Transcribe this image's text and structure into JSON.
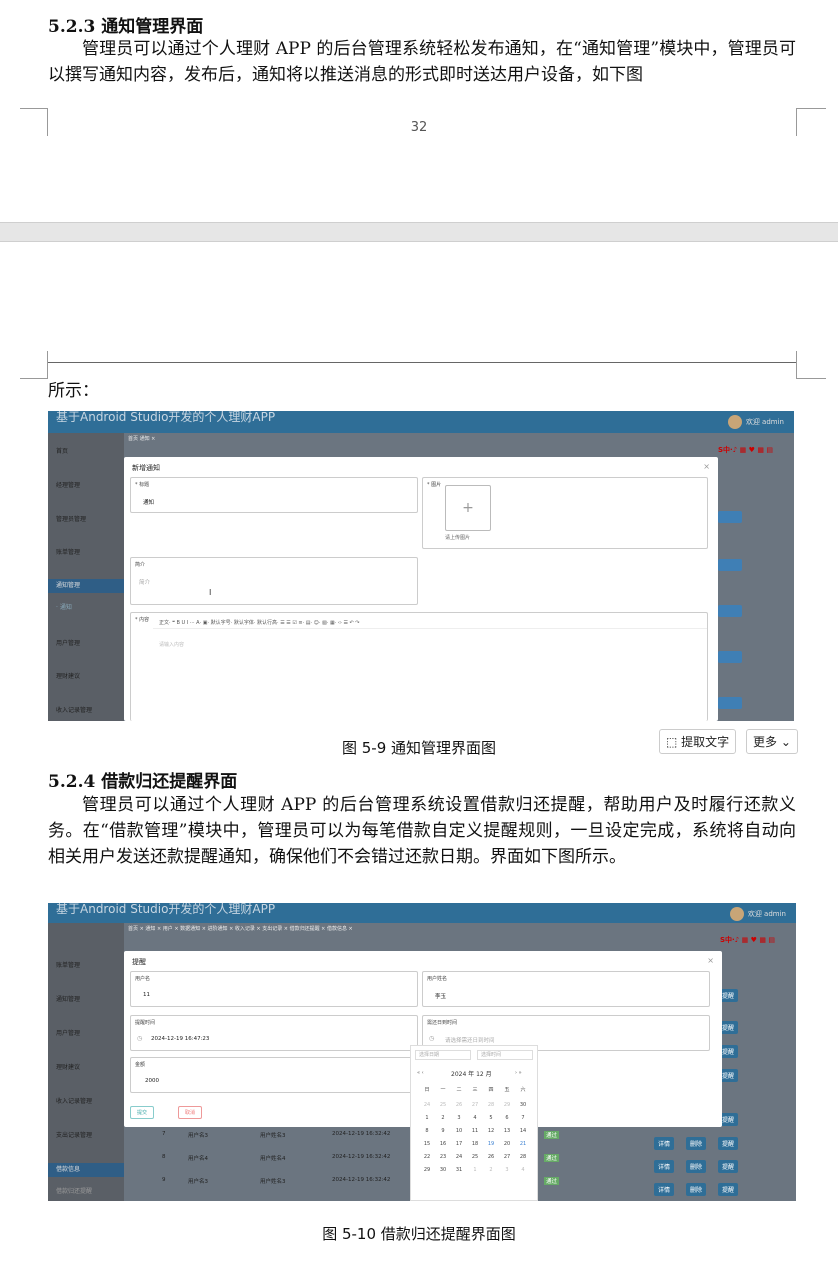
{
  "page1": {
    "heading": "5.2.3 通知管理界面",
    "paragraph": "管理员可以通过个人理财 APP 的后台管理系统轻松发布通知，在“通知管理”模块中，管理员可以撰写通知内容，发布后，通知将以推送消息的形式即时送达用户设备，如下图",
    "page_number": "32"
  },
  "page2": {
    "continuation": "所示：",
    "figure1": {
      "caption": "图 5-9 通知管理界面图",
      "app_title": "基于Android Studio开发的个人理财APP",
      "admin": "欢迎 admin",
      "tabs": "首页  通知 ×",
      "sidebar": [
        "首页",
        "经理管理",
        "管理员管理",
        "账单管理",
        "通知管理",
        "· 通知",
        "用户管理",
        "理财建议",
        "收入记录管理"
      ],
      "modal": {
        "title": "新增通知",
        "close": "×",
        "title_label": "* 标题",
        "title_value": "通知",
        "image_label": "* 图片",
        "image_hint": "请上传图片",
        "intro_label": "简介",
        "intro_placeholder": "简介",
        "content_label": "* 内容",
        "toolbar": "正文·   ❝   B  U  I  ···  A·  ▣·     默认字号·   默认字体·   默认行高·     ☰  ☰  ☑  ≡·  ▤·     ☺·  ▧·  ▦·  ‹›  ☰     ↶  ↷",
        "content_placeholder": "请输入内容"
      },
      "row_button": "通知",
      "ime": "S中·♪ ▦ ♥ ▦ ▤"
    },
    "tool_buttons": {
      "extract": "提取文字",
      "more": "更多"
    },
    "heading2": "5.2.4 借款归还提醒界面",
    "paragraph2": "管理员可以通过个人理财 APP 的后台管理系统设置借款归还提醒，帮助用户及时履行还款义务。在“借款管理”模块中，管理员可以为每笔借款自定义提醒规则，一旦设定完成，系统将自动向相关用户发送还款提醒通知，确保他们不会错过还款日期。界面如下图所示。",
    "figure2": {
      "caption": "图 5-10 借款归还提醒界面图",
      "app_title": "基于Android Studio开发的个人理财APP",
      "admin": "欢迎 admin",
      "tabs": "首页 × 通知 × 用户 × 数据通知 × 进阶通知 × 收入记录 × 支出记录 × 借款归还提醒 × 借款信息 ×",
      "sidebar": [
        "账单管理",
        "通知管理",
        "用户管理",
        "理财建议",
        "收入记录管理",
        "支出记录管理",
        "借款信息",
        "借款归还提醒"
      ],
      "modal": {
        "title": "提醒",
        "close": "×",
        "username_label": "用户名",
        "username_value": "11",
        "name_label": "用户姓名",
        "name_value": "李玉",
        "remind_time_label": "提醒时间",
        "remind_time_value": "2024-12-19 16:47:23",
        "due_time_label": "需还日到时间",
        "due_time_placeholder": "请选择需还日到时间",
        "amount_label": "金额",
        "amount_value": "2000",
        "confirm": "提交",
        "cancel": "取消"
      },
      "calendar": {
        "date_placeholder": "选择日期",
        "time_placeholder": "选择时间",
        "month": "2024 年  12 月",
        "weekdays": [
          "日",
          "一",
          "二",
          "三",
          "四",
          "五",
          "六"
        ],
        "days": [
          "24",
          "25",
          "26",
          "27",
          "28",
          "29",
          "30",
          "1",
          "2",
          "3",
          "4",
          "5",
          "6",
          "7",
          "8",
          "9",
          "10",
          "11",
          "12",
          "13",
          "14",
          "15",
          "16",
          "17",
          "18",
          "19",
          "20",
          "21",
          "22",
          "23",
          "24",
          "25",
          "26",
          "27",
          "28",
          "29",
          "30",
          "31",
          "1",
          "2",
          "3",
          "4"
        ]
      },
      "rows": [
        {
          "no": "7",
          "user": "用户名3",
          "name": "用户姓名3",
          "time": "2024-12-19 16:32:42",
          "status": "通过"
        },
        {
          "no": "8",
          "user": "用户名4",
          "name": "用户姓名4",
          "time": "2024-12-19 16:32:42",
          "status": "通过"
        },
        {
          "no": "9",
          "user": "用户名3",
          "name": "用户姓名3",
          "time": "2024-12-19 16:32:42",
          "status": "通过"
        }
      ],
      "row_actions": [
        "详情",
        "删除",
        "提醒"
      ]
    }
  }
}
